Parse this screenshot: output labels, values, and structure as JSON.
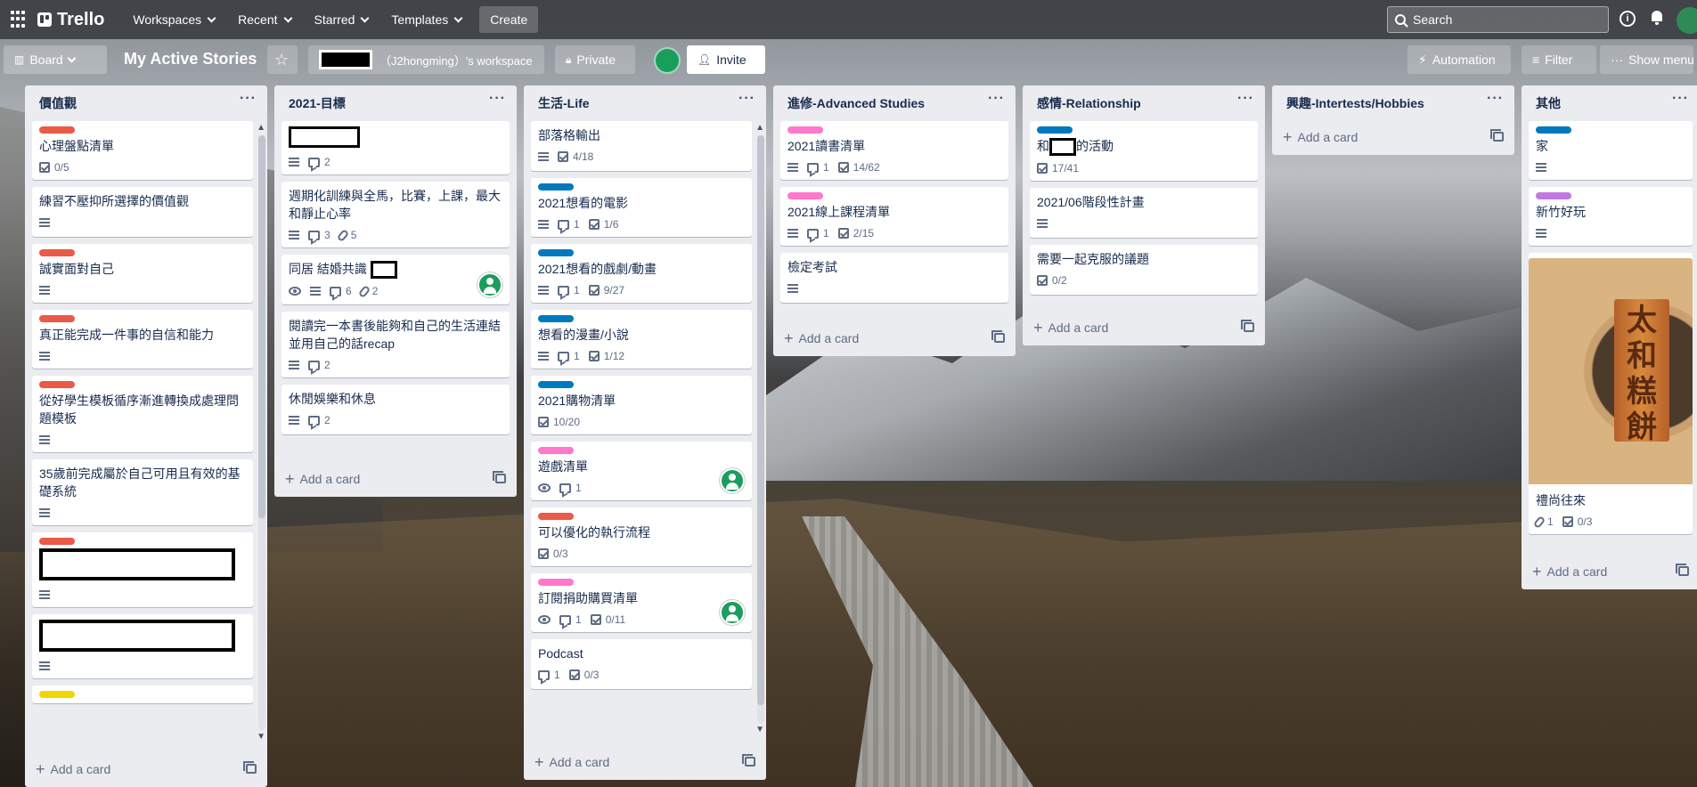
{
  "topbar": {
    "logo": "Trello",
    "nav": [
      {
        "label": "Workspaces"
      },
      {
        "label": "Recent"
      },
      {
        "label": "Starred"
      },
      {
        "label": "Templates"
      }
    ],
    "create_label": "Create",
    "search_placeholder": "Search"
  },
  "board": {
    "view_label": "Board",
    "title": "My Active Stories",
    "workspace_label": "（J2hongming）'s workspace",
    "visibility_label": "Private",
    "invite_label": "Invite",
    "automation_label": "Automation",
    "filter_label": "Filter",
    "show_menu_label": "Show menu"
  },
  "add_card_label": "Add a card",
  "colors": {
    "red": "#eb5a46",
    "blue": "#0079bf",
    "pink": "#ff78cb",
    "purple": "#c377e0",
    "yellow": "#f2d600",
    "green": "#1a9e5b"
  },
  "lists": [
    {
      "title": "價值觀",
      "cards": [
        {
          "label": "red",
          "title": "心理盤點清單",
          "checklist": "0/5"
        },
        {
          "title": "練習不壓抑所選擇的價值觀",
          "desc": true
        },
        {
          "label": "red",
          "title": "誠實面對自己",
          "desc": true
        },
        {
          "label": "red",
          "title": "真正能完成一件事的自信和能力",
          "desc": true
        },
        {
          "label": "red",
          "title": "從好學生模板循序漸進轉換成處理問題模板",
          "desc": true
        },
        {
          "title": "35歲前完成屬於自己可用且有效的基礎系統",
          "desc": true
        },
        {
          "label": "red",
          "redacted": true,
          "desc": true
        },
        {
          "redacted": true,
          "desc": true
        },
        {
          "label": "yellow",
          "title": ""
        }
      ]
    },
    {
      "title": "2021-目標",
      "cards": [
        {
          "redacted": true,
          "desc": true,
          "comments": "2"
        },
        {
          "title": "週期化訓練與全馬，比賽，上課，最大和靜止心率",
          "desc": true,
          "comments": "3",
          "attachments": "5"
        },
        {
          "title": "同居 結婚共識",
          "redacted_inline": true,
          "watch": true,
          "desc": true,
          "comments": "6",
          "attachments": "2",
          "avatar": true
        },
        {
          "title": "閱讀完一本書後能夠和自己的生活連結並用自己的話recap",
          "desc": true,
          "comments": "2"
        },
        {
          "title": "休閒娛樂和休息",
          "desc": true,
          "comments": "2"
        }
      ]
    },
    {
      "title": "生活-Life",
      "cards": [
        {
          "title": "部落格輸出",
          "desc": true,
          "checklist": "4/18"
        },
        {
          "label": "blue",
          "title": "2021想看的電影",
          "desc": true,
          "comments": "1",
          "checklist": "1/6"
        },
        {
          "label": "blue",
          "title": "2021想看的戲劇/動畫",
          "desc": true,
          "comments": "1",
          "checklist": "9/27"
        },
        {
          "label": "blue",
          "title": "想看的漫畫/小說",
          "desc": true,
          "comments": "1",
          "checklist": "1/12"
        },
        {
          "label": "blue",
          "title": "2021購物清單",
          "checklist": "10/20"
        },
        {
          "label": "pink",
          "title": "遊戲清單",
          "watch": true,
          "comments": "1",
          "avatar": true
        },
        {
          "label": "red",
          "title": "可以優化的執行流程",
          "checklist": "0/3"
        },
        {
          "label": "pink",
          "title": "訂閱捐助購買清單",
          "watch": true,
          "comments": "1",
          "checklist": "0/11",
          "avatar": true
        },
        {
          "title": "Podcast",
          "comments": "1",
          "checklist": "0/3"
        }
      ]
    },
    {
      "title": "進修-Advanced Studies",
      "cards": [
        {
          "label": "pink",
          "title": "2021讀書清單",
          "desc": true,
          "comments": "1",
          "checklist": "14/62"
        },
        {
          "label": "pink",
          "title": "2021線上課程清單",
          "desc": true,
          "comments": "1",
          "checklist": "2/15"
        },
        {
          "title": "檢定考試",
          "desc": true
        }
      ]
    },
    {
      "title": "感情-Relationship",
      "cards": [
        {
          "label": "blue",
          "title_a": "和",
          "title_b": "的活動",
          "redacted_mid": true,
          "checklist": "17/41"
        },
        {
          "title": "2021/06階段性計畫",
          "desc": true
        },
        {
          "title": "需要一起克服的議題",
          "checklist": "0/2"
        }
      ]
    },
    {
      "title": "興趣-Intertests/Hobbies",
      "cards": []
    },
    {
      "title": "其他",
      "cards": [
        {
          "label": "blue",
          "title": "家",
          "desc": true
        },
        {
          "label": "purple",
          "title": "新竹好玩",
          "desc": true
        },
        {
          "image": true,
          "image_text": "太和糕餅",
          "title": "禮尚往來",
          "attachments": "1",
          "checklist": "0/3"
        }
      ]
    }
  ]
}
